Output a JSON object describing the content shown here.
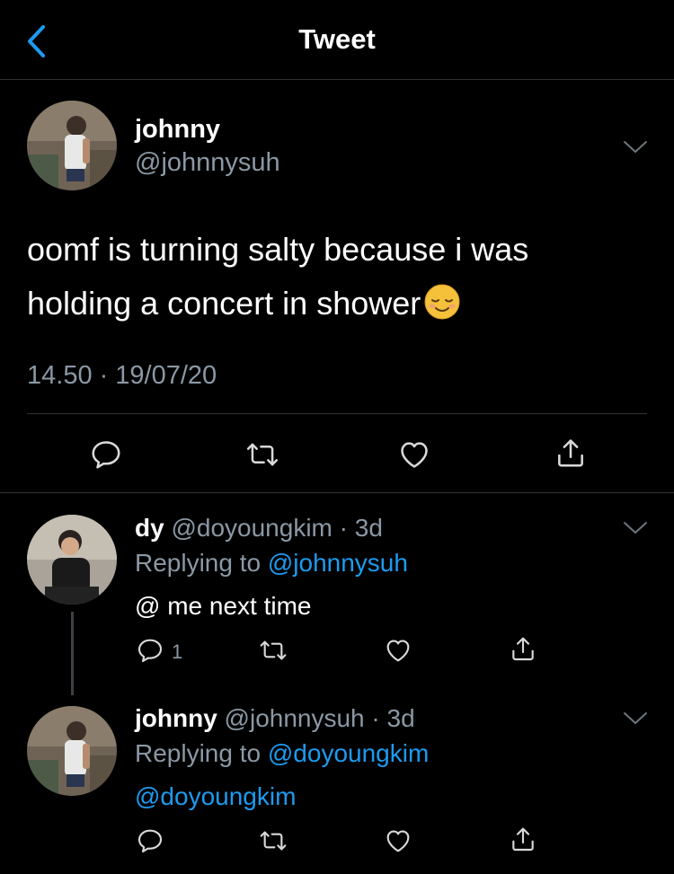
{
  "header": {
    "title": "Tweet"
  },
  "main_tweet": {
    "name": "johnny",
    "handle": "@johnnysuh",
    "text_line1": "oomf is turning salty because i was",
    "text_line2": "holding a concert in shower",
    "time": "14.50",
    "date": "19/07/20"
  },
  "replies": [
    {
      "name": "dy",
      "handle": "@doyoungkim",
      "age": "3d",
      "replying_prefix": "Replying to",
      "replying_to": "@johnnysuh",
      "text": "@ me next time",
      "reply_count": "1"
    },
    {
      "name": "johnny",
      "handle": "@johnnysuh",
      "age": "3d",
      "replying_prefix": "Replying to",
      "replying_to": "@doyoungkim",
      "text": "@doyoungkim",
      "reply_count": ""
    }
  ],
  "colors": {
    "accent": "#1d9bf0",
    "secondary_text": "#8b98a5",
    "background": "#000000"
  },
  "icons": [
    "back-chevron-icon",
    "chevron-down-icon",
    "reply-icon",
    "retweet-icon",
    "like-icon",
    "share-icon",
    "relieved-face-emoji"
  ]
}
